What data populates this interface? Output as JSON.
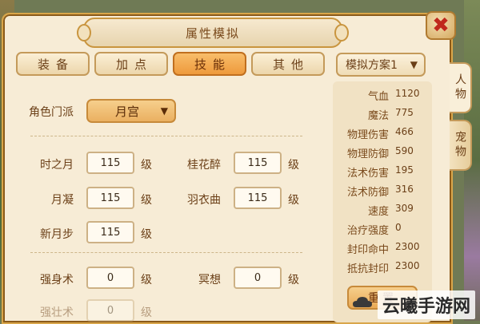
{
  "window": {
    "title": "属性模拟",
    "close_glyph": "✖"
  },
  "tabs": [
    {
      "label": "装备",
      "active": false
    },
    {
      "label": "加点",
      "active": false
    },
    {
      "label": "技能",
      "active": true
    },
    {
      "label": "其他",
      "active": false
    }
  ],
  "scheme": {
    "label": "模拟方案1"
  },
  "side_tabs": [
    {
      "label": "人物",
      "active": true
    },
    {
      "label": "宠物",
      "active": false
    }
  ],
  "school": {
    "label": "角色门派",
    "value": "月宫"
  },
  "skills": {
    "unit": "级",
    "faction": [
      {
        "name": "时之月",
        "value": "115"
      },
      {
        "name": "桂花醉",
        "value": "115"
      },
      {
        "name": "月凝",
        "value": "115"
      },
      {
        "name": "羽衣曲",
        "value": "115"
      },
      {
        "name": "新月步",
        "value": "115"
      }
    ],
    "aux": [
      {
        "name": "强身术",
        "value": "0"
      },
      {
        "name": "冥想",
        "value": "0"
      },
      {
        "name": "强壮术",
        "value": "0"
      }
    ]
  },
  "stats": [
    {
      "label": "气血",
      "value": "1120"
    },
    {
      "label": "魔法",
      "value": "775"
    },
    {
      "label": "物理伤害",
      "value": "466"
    },
    {
      "label": "物理防御",
      "value": "590"
    },
    {
      "label": "法术伤害",
      "value": "195"
    },
    {
      "label": "法术防御",
      "value": "316"
    },
    {
      "label": "速度",
      "value": "309"
    },
    {
      "label": "治疗强度",
      "value": "0"
    },
    {
      "label": "封印命中",
      "value": "2300"
    },
    {
      "label": "抵抗封印",
      "value": "2300"
    }
  ],
  "reset_label": "重置",
  "watermark": "云曦手游网",
  "colors": {
    "accent": "#ee9a3c",
    "panel": "#f7ecd6",
    "border": "#c49a5a",
    "close": "#c0281c"
  }
}
